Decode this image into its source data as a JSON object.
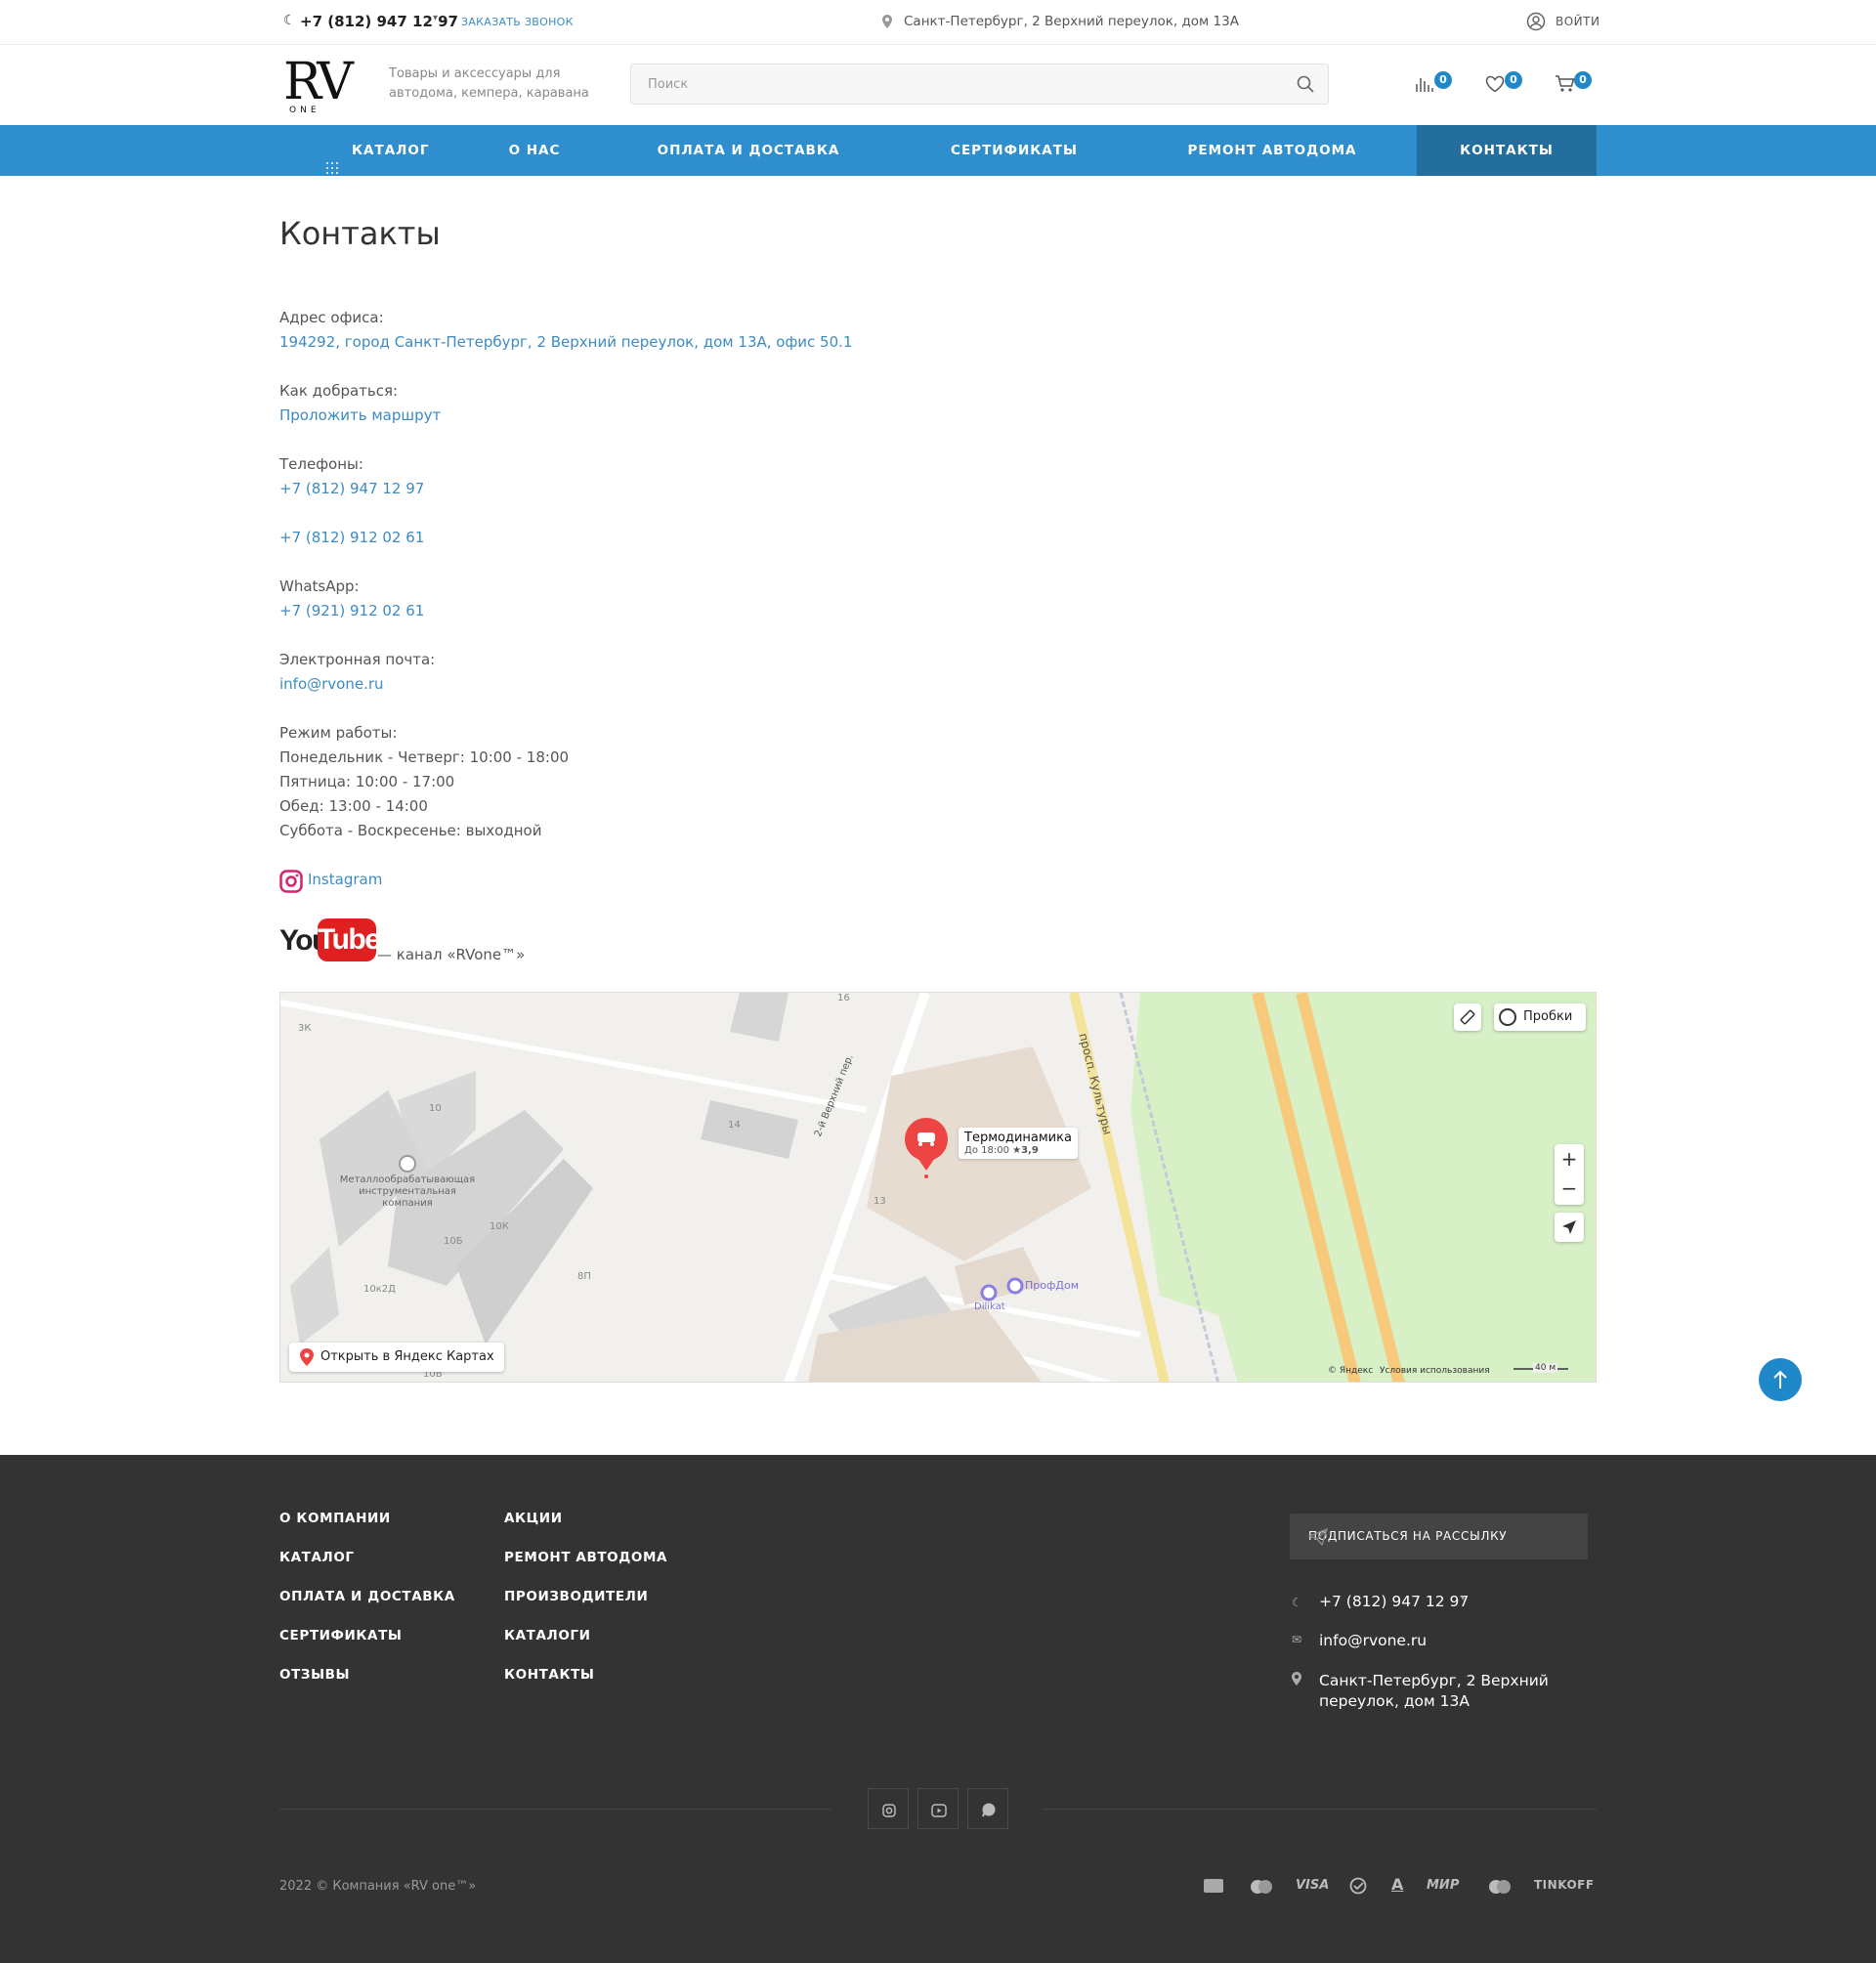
{
  "topbar": {
    "phone": "+7 (812) 947 12 97",
    "callback": "ЗАКАЗАТЬ ЗВОНОК",
    "address": "Санкт-Петербург, 2 Верхний переулок, дом 13А",
    "login": "ВОЙТИ"
  },
  "header": {
    "logo_main": "RV",
    "logo_sub": "ONE",
    "tagline": "Товары и аксессуары для автодома, кемпера, каравана",
    "search_placeholder": "Поиск",
    "compare_count": "0",
    "favorites_count": "0",
    "cart_count": "0"
  },
  "nav": {
    "items": [
      {
        "label": "КАТАЛОГ"
      },
      {
        "label": "О НАС"
      },
      {
        "label": "ОПЛАТА И ДОСТАВКА"
      },
      {
        "label": "СЕРТИФИКАТЫ"
      },
      {
        "label": "РЕМОНТ АВТОДОМА"
      },
      {
        "label": "КОНТАКТЫ"
      }
    ],
    "active": "КОНТАКТЫ"
  },
  "page": {
    "title": "Контакты",
    "office_label": "Адрес офиса:",
    "office_address": "194292, город Санкт-Петербург, 2 Верхний переулок, дом 13А, офис 50.1",
    "route_label": "Как добраться:",
    "route_link": "Проложить маршрут",
    "phones_label": "Телефоны:",
    "phone1": "+7 (812) 947 12 97",
    "phone2": "+7 (812) 912 02 61",
    "whatsapp_label": "WhatsApp:",
    "whatsapp": "+7 (921) 912 02 61",
    "email_label": "Электронная почта:",
    "email": "info@rvone.ru",
    "hours_label": "Режим работы:",
    "hours": [
      "Понедельник - Четверг: 10:00 - 18:00",
      "Пятница: 10:00 - 17:00",
      "Обед: 13:00 - 14:00",
      "Суббота - Воскресенье: выходной"
    ],
    "instagram": "Instagram",
    "youtube_logo_you": "You",
    "youtube_logo_tube": "Tube",
    "youtube_channel": "— канал «RVone™»"
  },
  "map": {
    "traffic": "Пробки",
    "place_name": "Термодинамика",
    "place_hours": "До 18:00",
    "place_rating": "★3,9",
    "open_in_yandex": "Открыть в Яндекс Картах",
    "copyright": "© Яндекс",
    "terms": "Условия использования",
    "scale": "40 м",
    "labels": {
      "street1": "2-й Верхний пер.",
      "street2": "просп. Культуры",
      "company": "Металлообрабатывающая инструментальная компания",
      "profdom": "ПрофДом",
      "dilikat": "Dilikat",
      "b13": "13",
      "b14": "14",
      "b10": "10",
      "b10k": "10К",
      "b10b": "10Б",
      "b10k2d": "10к2Д",
      "b8p": "8П",
      "b3k": "3К",
      "b10v": "10В",
      "b16": "16"
    },
    "zoom_in": "+",
    "zoom_out": "−"
  },
  "footer": {
    "col1": [
      "О КОМПАНИИ",
      "КАТАЛОГ",
      "ОПЛАТА И ДОСТАВКА",
      "СЕРТИФИКАТЫ",
      "ОТЗЫВЫ"
    ],
    "col2": [
      "АКЦИИ",
      "РЕМОНТ АВТОДОМА",
      "ПРОИЗВОДИТЕЛИ",
      "КАТАЛОГИ",
      "КОНТАКТЫ"
    ],
    "subscribe": "ПОДПИСАТЬСЯ НА РАССЫЛКУ",
    "phone": "+7 (812) 947 12 97",
    "email": "info@rvone.ru",
    "address": "Санкт-Петербург, 2 Верхний переулок, дом 13А",
    "copyright": "2022 © Компания «RV one™»",
    "payments": [
      "VISA",
      "МИР",
      "TINKOFF"
    ]
  },
  "colors": {
    "accent": "#2f8fce",
    "nav_active": "#236e9d",
    "link": "#3d8bc2",
    "badge": "#1f88c9",
    "footer_bg": "#333333"
  }
}
